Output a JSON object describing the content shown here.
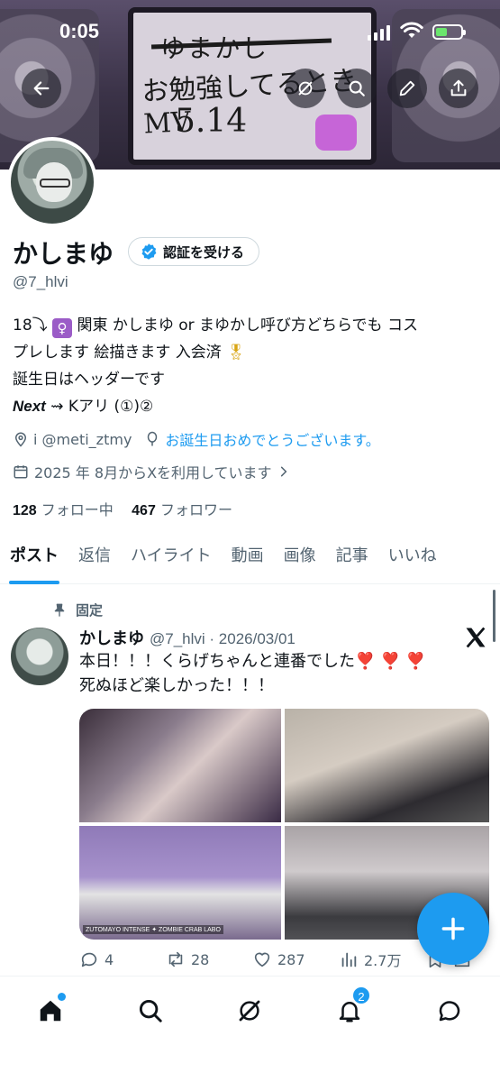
{
  "status": {
    "time": "0:05"
  },
  "banner": {
    "line1": "ゆまかし",
    "line2": "お勉強してるときMV",
    "line3": "5.14"
  },
  "profile": {
    "name": "かしまゆ",
    "verify_label": "認証を受ける",
    "handle": "@7_hlvi",
    "bio": {
      "line1_a": "18⤵︎",
      "line1_b": "関東 かしまゆ or まゆかし呼び方どちらでも コス",
      "line2": "プレします 絵描きます 入会済",
      "line3": "誕生日はヘッダーです",
      "line4_bold": "Next",
      "line4_arrow": " ⇝ ",
      "line4_rest": "Kアリ (①)②"
    },
    "location": "i @meti_ztmy",
    "birthday": "お誕生日おめでとうございます。",
    "joined": "2025 年 8月からXを利用しています",
    "following_count": "128",
    "following_label": "フォロー中",
    "followers_count": "467",
    "followers_label": "フォロワー"
  },
  "tabs": [
    "ポスト",
    "返信",
    "ハイライト",
    "動画",
    "画像",
    "記事",
    "いいね"
  ],
  "post": {
    "pinned_label": "固定",
    "author": "かしまゆ",
    "handle_date": "@7_hlvi · 2026/03/01",
    "line1": "本日！！！くらげちゃんと連番でした",
    "hearts": "❣️ ❣️ ❣️",
    "line2": "死ぬほど楽しかった！！！",
    "photo_caption": "ZUTOMAYO INTENSE ✦ ZOMBIE CRAB LABO",
    "replies": "4",
    "reposts": "28",
    "likes": "287",
    "views": "2.7万"
  },
  "nav": {
    "notifications_badge": "2"
  },
  "colors": {
    "accent": "#1d9bf0",
    "text": "#0f1419",
    "muted": "#536471"
  }
}
